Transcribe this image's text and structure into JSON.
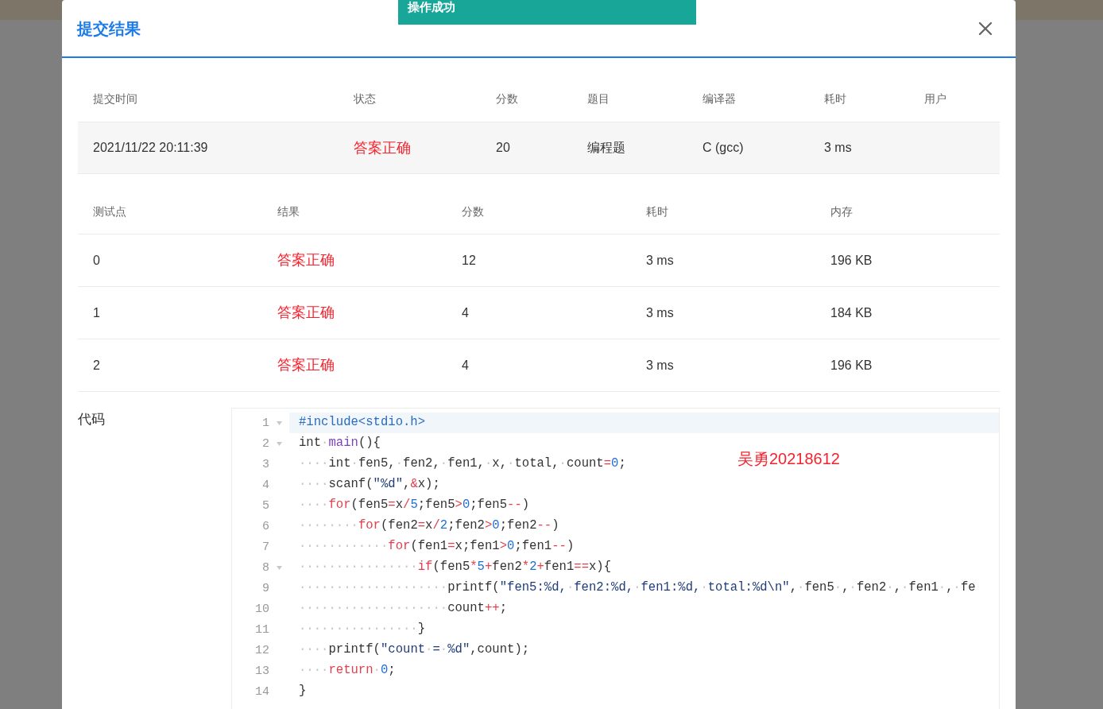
{
  "toast": {
    "text": "操作成功"
  },
  "dialog": {
    "title": "提交结果"
  },
  "submission": {
    "columns": [
      "提交时间",
      "状态",
      "分数",
      "题目",
      "编译器",
      "耗时",
      "用户"
    ],
    "cells": [
      {
        "text": "2021/11/22 20:11:39",
        "kind": "plain"
      },
      {
        "text": "答案正确",
        "kind": "verdict"
      },
      {
        "text": "20",
        "kind": "plain"
      },
      {
        "text": "编程题",
        "kind": "plain"
      },
      {
        "text": "C (gcc)",
        "kind": "plain"
      },
      {
        "text": "3 ms",
        "kind": "plain"
      }
    ]
  },
  "testcases": {
    "columns": [
      "测试点",
      "结果",
      "分数",
      "耗时",
      "内存"
    ],
    "rows": [
      {
        "cells": [
          {
            "text": "0",
            "kind": "plain"
          },
          {
            "text": "答案正确",
            "kind": "verdict"
          },
          {
            "text": "12",
            "kind": "plain"
          },
          {
            "text": "3 ms",
            "kind": "plain"
          },
          {
            "text": "196 KB",
            "kind": "plain"
          }
        ]
      },
      {
        "cells": [
          {
            "text": "1",
            "kind": "plain"
          },
          {
            "text": "答案正确",
            "kind": "verdict"
          },
          {
            "text": "4",
            "kind": "plain"
          },
          {
            "text": "3 ms",
            "kind": "plain"
          },
          {
            "text": "184 KB",
            "kind": "plain"
          }
        ]
      },
      {
        "cells": [
          {
            "text": "2",
            "kind": "plain"
          },
          {
            "text": "答案正确",
            "kind": "verdict"
          },
          {
            "text": "4",
            "kind": "plain"
          },
          {
            "text": "3 ms",
            "kind": "plain"
          },
          {
            "text": "196 KB",
            "kind": "plain"
          }
        ]
      }
    ]
  },
  "code": {
    "label": "代码",
    "annotation": "吴勇20218612",
    "lines": [
      {
        "number": "1",
        "foldable": true,
        "highlighted": true,
        "tokens": [
          {
            "text": "#include<stdio.h>",
            "kind": "include"
          }
        ]
      },
      {
        "number": "2",
        "foldable": true,
        "highlighted": false,
        "tokens": [
          {
            "text": "int",
            "kind": "plain"
          },
          {
            "text": "·",
            "kind": "space"
          },
          {
            "text": "main",
            "kind": "function"
          },
          {
            "text": "(){",
            "kind": "plain"
          }
        ]
      },
      {
        "number": "3",
        "foldable": false,
        "highlighted": false,
        "tokens": [
          {
            "text": "····",
            "kind": "space"
          },
          {
            "text": "int",
            "kind": "plain"
          },
          {
            "text": "·",
            "kind": "space"
          },
          {
            "text": "fen5,",
            "kind": "plain"
          },
          {
            "text": "·",
            "kind": "space"
          },
          {
            "text": "fen2,",
            "kind": "plain"
          },
          {
            "text": "·",
            "kind": "space"
          },
          {
            "text": "fen1,",
            "kind": "plain"
          },
          {
            "text": "·",
            "kind": "space"
          },
          {
            "text": "x,",
            "kind": "plain"
          },
          {
            "text": "·",
            "kind": "space"
          },
          {
            "text": "total,",
            "kind": "plain"
          },
          {
            "text": "·",
            "kind": "space"
          },
          {
            "text": "count",
            "kind": "plain"
          },
          {
            "text": "=",
            "kind": "operator"
          },
          {
            "text": "0",
            "kind": "number"
          },
          {
            "text": ";",
            "kind": "plain"
          }
        ]
      },
      {
        "number": "4",
        "foldable": false,
        "highlighted": false,
        "tokens": [
          {
            "text": "····",
            "kind": "space"
          },
          {
            "text": "scanf(",
            "kind": "plain"
          },
          {
            "text": "\"%d\"",
            "kind": "string"
          },
          {
            "text": ",",
            "kind": "plain"
          },
          {
            "text": "&",
            "kind": "operator"
          },
          {
            "text": "x);",
            "kind": "plain"
          }
        ]
      },
      {
        "number": "5",
        "foldable": false,
        "highlighted": false,
        "tokens": [
          {
            "text": "····",
            "kind": "space"
          },
          {
            "text": "for",
            "kind": "keyword"
          },
          {
            "text": "(fen5",
            "kind": "plain"
          },
          {
            "text": "=",
            "kind": "operator"
          },
          {
            "text": "x",
            "kind": "plain"
          },
          {
            "text": "/",
            "kind": "operator"
          },
          {
            "text": "5",
            "kind": "number"
          },
          {
            "text": ";fen5",
            "kind": "plain"
          },
          {
            "text": ">",
            "kind": "operator"
          },
          {
            "text": "0",
            "kind": "number"
          },
          {
            "text": ";fen5",
            "kind": "plain"
          },
          {
            "text": "--",
            "kind": "operator"
          },
          {
            "text": ")",
            "kind": "plain"
          }
        ]
      },
      {
        "number": "6",
        "foldable": false,
        "highlighted": false,
        "tokens": [
          {
            "text": "········",
            "kind": "space"
          },
          {
            "text": "for",
            "kind": "keyword"
          },
          {
            "text": "(fen2",
            "kind": "plain"
          },
          {
            "text": "=",
            "kind": "operator"
          },
          {
            "text": "x",
            "kind": "plain"
          },
          {
            "text": "/",
            "kind": "operator"
          },
          {
            "text": "2",
            "kind": "number"
          },
          {
            "text": ";fen2",
            "kind": "plain"
          },
          {
            "text": ">",
            "kind": "operator"
          },
          {
            "text": "0",
            "kind": "number"
          },
          {
            "text": ";fen2",
            "kind": "plain"
          },
          {
            "text": "--",
            "kind": "operator"
          },
          {
            "text": ")",
            "kind": "plain"
          }
        ]
      },
      {
        "number": "7",
        "foldable": false,
        "highlighted": false,
        "tokens": [
          {
            "text": "············",
            "kind": "space"
          },
          {
            "text": "for",
            "kind": "keyword"
          },
          {
            "text": "(fen1",
            "kind": "plain"
          },
          {
            "text": "=",
            "kind": "operator"
          },
          {
            "text": "x;fen1",
            "kind": "plain"
          },
          {
            "text": ">",
            "kind": "operator"
          },
          {
            "text": "0",
            "kind": "number"
          },
          {
            "text": ";fen1",
            "kind": "plain"
          },
          {
            "text": "--",
            "kind": "operator"
          },
          {
            "text": ")",
            "kind": "plain"
          }
        ]
      },
      {
        "number": "8",
        "foldable": true,
        "highlighted": false,
        "tokens": [
          {
            "text": "················",
            "kind": "space"
          },
          {
            "text": "if",
            "kind": "keyword"
          },
          {
            "text": "(fen5",
            "kind": "plain"
          },
          {
            "text": "*",
            "kind": "operator"
          },
          {
            "text": "5",
            "kind": "number"
          },
          {
            "text": "+",
            "kind": "operator"
          },
          {
            "text": "fen2",
            "kind": "plain"
          },
          {
            "text": "*",
            "kind": "operator"
          },
          {
            "text": "2",
            "kind": "number"
          },
          {
            "text": "+",
            "kind": "operator"
          },
          {
            "text": "fen1",
            "kind": "plain"
          },
          {
            "text": "==",
            "kind": "operator"
          },
          {
            "text": "x){",
            "kind": "plain"
          }
        ]
      },
      {
        "number": "9",
        "foldable": false,
        "highlighted": false,
        "tokens": [
          {
            "text": "····················",
            "kind": "space"
          },
          {
            "text": "printf(",
            "kind": "plain"
          },
          {
            "text": "\"fen5:%d,",
            "kind": "string"
          },
          {
            "text": "·",
            "kind": "space"
          },
          {
            "text": "fen2:%d,",
            "kind": "string"
          },
          {
            "text": "·",
            "kind": "space"
          },
          {
            "text": "fen1:%d,",
            "kind": "string"
          },
          {
            "text": "·",
            "kind": "space"
          },
          {
            "text": "total:%d\\n\"",
            "kind": "string"
          },
          {
            "text": ",",
            "kind": "plain"
          },
          {
            "text": "·",
            "kind": "space"
          },
          {
            "text": "fen5",
            "kind": "plain"
          },
          {
            "text": "·",
            "kind": "space"
          },
          {
            "text": ",",
            "kind": "plain"
          },
          {
            "text": "·",
            "kind": "space"
          },
          {
            "text": "fen2",
            "kind": "plain"
          },
          {
            "text": "·",
            "kind": "space"
          },
          {
            "text": ",",
            "kind": "plain"
          },
          {
            "text": "·",
            "kind": "space"
          },
          {
            "text": "fen1",
            "kind": "plain"
          },
          {
            "text": "·",
            "kind": "space"
          },
          {
            "text": ",",
            "kind": "plain"
          },
          {
            "text": "·",
            "kind": "space"
          },
          {
            "text": "fe",
            "kind": "plain"
          }
        ]
      },
      {
        "number": "10",
        "foldable": false,
        "highlighted": false,
        "tokens": [
          {
            "text": "····················",
            "kind": "space"
          },
          {
            "text": "count",
            "kind": "plain"
          },
          {
            "text": "++",
            "kind": "operator"
          },
          {
            "text": ";",
            "kind": "plain"
          }
        ]
      },
      {
        "number": "11",
        "foldable": false,
        "highlighted": false,
        "tokens": [
          {
            "text": "················",
            "kind": "space"
          },
          {
            "text": "}",
            "kind": "plain"
          }
        ]
      },
      {
        "number": "12",
        "foldable": false,
        "highlighted": false,
        "tokens": [
          {
            "text": "····",
            "kind": "space"
          },
          {
            "text": "printf(",
            "kind": "plain"
          },
          {
            "text": "\"count",
            "kind": "string"
          },
          {
            "text": "·",
            "kind": "space"
          },
          {
            "text": "=",
            "kind": "string"
          },
          {
            "text": "·",
            "kind": "space"
          },
          {
            "text": "%d\"",
            "kind": "string"
          },
          {
            "text": ",count);",
            "kind": "plain"
          }
        ]
      },
      {
        "number": "13",
        "foldable": false,
        "highlighted": false,
        "tokens": [
          {
            "text": "····",
            "kind": "space"
          },
          {
            "text": "return",
            "kind": "keyword"
          },
          {
            "text": "·",
            "kind": "space"
          },
          {
            "text": "0",
            "kind": "number"
          },
          {
            "text": ";",
            "kind": "plain"
          }
        ]
      },
      {
        "number": "14",
        "foldable": false,
        "highlighted": false,
        "tokens": [
          {
            "text": "}",
            "kind": "plain"
          }
        ]
      }
    ]
  }
}
